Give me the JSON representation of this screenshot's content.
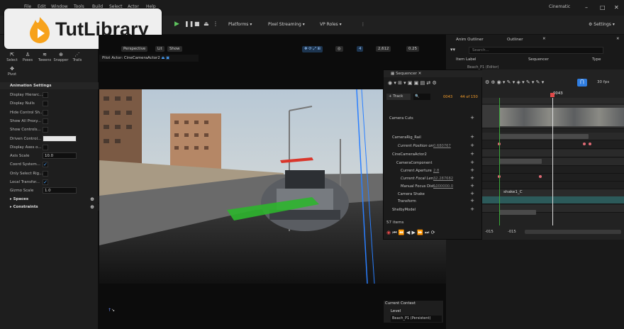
{
  "window": {
    "title": "Cinematic",
    "menu": [
      "File",
      "Edit",
      "Window",
      "Tools",
      "Build",
      "Select",
      "Actor",
      "Help"
    ],
    "tab": "Beach_P1*"
  },
  "watermark": {
    "text": "TutLibrary"
  },
  "toolbar": {
    "platforms": "Platforms",
    "pixel_streaming": "Pixel Streaming",
    "vp_roles": "VP Roles",
    "settings": "Settings"
  },
  "left": {
    "title": "Animation",
    "modes": [
      "Select",
      "Poses",
      "Tweens",
      "Snapper",
      "Trails",
      "Pivot"
    ],
    "section": "Animation Settings",
    "rows": [
      {
        "label": "Display Hierarc...",
        "type": "cb",
        "on": false
      },
      {
        "label": "Display Nulls",
        "type": "cb",
        "on": false
      },
      {
        "label": "Hide Control Sh...",
        "type": "cb",
        "on": false
      },
      {
        "label": "Show All Proxy...",
        "type": "cb",
        "on": false
      },
      {
        "label": "Show Controls...",
        "type": "cb",
        "on": false
      },
      {
        "label": "Driven Control...",
        "type": "color"
      },
      {
        "label": "Display Axes o...",
        "type": "cb",
        "on": false
      },
      {
        "label": "Axis Scale",
        "type": "num",
        "value": "10.0"
      },
      {
        "label": "Coord System...",
        "type": "cb",
        "on": true
      },
      {
        "label": "Only Select Rig...",
        "type": "cb",
        "on": false
      },
      {
        "label": "Local Transfor...",
        "type": "cb",
        "on": true
      },
      {
        "label": "Gizmo Scale",
        "type": "num",
        "value": "1.0"
      }
    ],
    "spaces": "Spaces",
    "constraints": "Constraints"
  },
  "viewport": {
    "perspective": "Perspective",
    "lit": "Lit",
    "show": "Show",
    "pilot": "Pilot Actor: CineCameraActor2",
    "speed": "2,612",
    "fov": "0.25",
    "num": "4"
  },
  "outliner": {
    "tab1": "Anim Outliner",
    "tab2": "Outliner",
    "search": "Search...",
    "col_label": "Item Label",
    "col_seq": "Sequencer",
    "col_type": "Type",
    "row": "Beach_P1 (Editor)"
  },
  "sequencer": {
    "tab": "Sequencer",
    "track": "Track",
    "frame": "0043",
    "of": "44 of 150",
    "fps": "30 fps",
    "playhead": "0043",
    "items": "57 items",
    "start": "-015",
    "end": "-015",
    "tracks": [
      {
        "name": "Camera Cuts",
        "ind": 4
      },
      {
        "name": "CameraRig_Rail",
        "ind": 8
      },
      {
        "name": "Current Position on",
        "val": "0.680767",
        "ind": 16,
        "it": true
      },
      {
        "name": "CineCameraActor2",
        "ind": 8
      },
      {
        "name": "CameraComponent",
        "ind": 14
      },
      {
        "name": "Current Aperture",
        "val": "2.8",
        "ind": 20
      },
      {
        "name": "Current Focal Len...",
        "val": "32.287682",
        "ind": 20,
        "it": true
      },
      {
        "name": "Manual Focus Dist...",
        "val": "1000000.0",
        "ind": 20
      },
      {
        "name": "Camera Shake",
        "ind": 16
      },
      {
        "name": "Transform",
        "ind": 16
      },
      {
        "name": "ShelbyModel",
        "ind": 8
      }
    ],
    "shake": "shake1_C"
  },
  "context": {
    "title": "Current Context",
    "level": "Level",
    "value": "Beach_P1 (Persistent)"
  }
}
